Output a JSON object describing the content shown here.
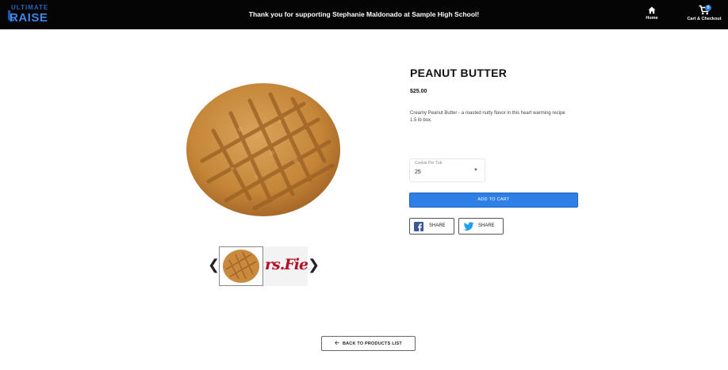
{
  "header": {
    "logo_top": "ULTIMATE",
    "logo_main": "RAISE",
    "message": "Thank you for supporting Stephanie Maldonado at Sample High School!",
    "home_label": "Home",
    "cart_label": "Cart & Checkout",
    "cart_count": "0"
  },
  "product": {
    "title": "PEANUT BUTTER",
    "price": "$25.00",
    "description_line1": "Creamy Peanut Butter - a roasted nutty flavor in this heart warming recipe",
    "description_line2": "1.5 lb box.",
    "select": {
      "label": "Cookie Per Tub",
      "value": "25"
    },
    "add_to_cart": "ADD TO CART",
    "share_facebook": "SHARE",
    "share_twitter": "SHARE",
    "thumb_brand_text": "rs.Fiela"
  },
  "back_button": "BACK TO PRODUCTS LIST",
  "colors": {
    "header_bg": "#050505",
    "accent": "#2f80e6",
    "cookie": "#c98a3e"
  }
}
